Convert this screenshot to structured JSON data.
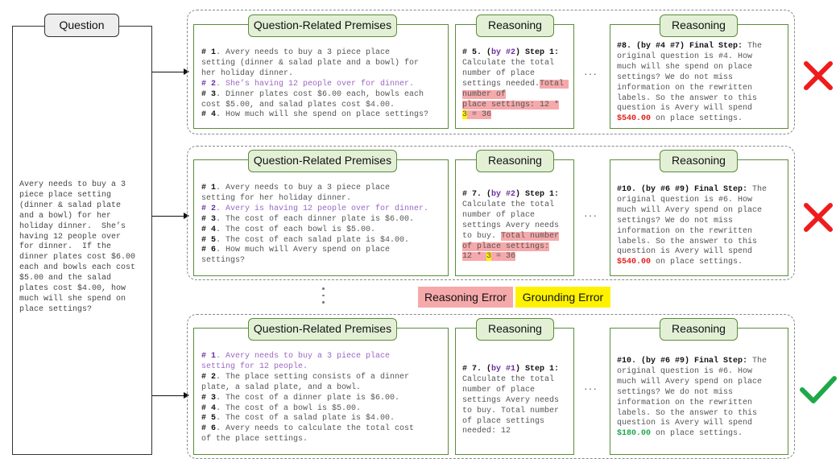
{
  "question": {
    "label": "Question",
    "text": "Avery needs to buy a 3\npiece place setting\n(dinner & salad plate\nand a bowl) for her\nholiday dinner.  She’s\nhaving 12 people over\nfor dinner.  If the\ndinner plates cost $6.00\neach and bowls each cost\n$5.00 and the salad\nplates cost $4.00, how\nmuch will she spend on\nplace settings?"
  },
  "legend": {
    "reasoning_error": "Reasoning Error",
    "grounding_error": "Grounding Error",
    "reasoning_error_color": "#f6a9ab",
    "grounding_error_color": "#fff200"
  },
  "ellipsis": "···",
  "rows": [
    {
      "premises_title": "Question-Related Premises",
      "premises": [
        {
          "num": "# 1",
          "text": ". Avery needs to buy a 3 piece place\nsetting (dinner & salad plate and a bowl) for\nher holiday dinner.",
          "highlight": false
        },
        {
          "num": "# 2",
          "text": ". She’s having 12 people over for dinner.",
          "highlight": true
        },
        {
          "num": "# 3",
          "text": ". Dinner plates cost $6.00 each, bowls each\ncost $5.00, and salad plates cost $4.00.",
          "highlight": false
        },
        {
          "num": "# 4",
          "text": ". How much will she spend on place settings?",
          "highlight": false
        }
      ],
      "step_title": "Reasoning",
      "step": {
        "head_a": "# 5. (",
        "by": "by #2",
        "head_b": ") Step 1:",
        "text": "Calculate the total\nnumber of place\nsettings needed.",
        "error_pre": "Total number of\nplace settings: 12 *\n",
        "error_ground": "3",
        "error_post": " = 36"
      },
      "final_title": "Reasoning",
      "final": {
        "head": "#8. (by #4 #7) Final Step:",
        "text": " The\noriginal question is #4. How\nmuch will she spend on place\nsettings? We do not miss\ninformation on the rewritten\nlabels. So the answer to this\nquestion is Avery will spend\n",
        "amount": "$540.00",
        "tail": " on place settings."
      },
      "verdict": "wrong"
    },
    {
      "premises_title": "Question-Related Premises",
      "premises": [
        {
          "num": "# 1",
          "text": ". Avery needs to buy a 3 piece place\nsetting for her holiday dinner.",
          "highlight": false
        },
        {
          "num": "# 2",
          "text": ". Avery is having 12 people over for dinner.",
          "highlight": true
        },
        {
          "num": "# 3",
          "text": ". The cost of each dinner plate is $6.00.",
          "highlight": false
        },
        {
          "num": "# 4",
          "text": ". The cost of each bowl is $5.00.",
          "highlight": false
        },
        {
          "num": "# 5",
          "text": ". The cost of each salad plate is $4.00.",
          "highlight": false
        },
        {
          "num": "# 6",
          "text": ". How much will Avery spend on place\nsettings?",
          "highlight": false
        }
      ],
      "step_title": "Reasoning",
      "step": {
        "head_a": "# 7. (",
        "by": "by #2",
        "head_b": ") Step 1:",
        "text": "Calculate the total\nnumber of place\nsettings Avery needs\nto buy. ",
        "error_pre": "Total number\nof place settings:\n12 * ",
        "error_ground": "3",
        "error_post": " = 36"
      },
      "final_title": "Reasoning",
      "final": {
        "head": "#10. (by #6 #9) Final Step:",
        "text": " The\noriginal question is #6. How\nmuch will Avery spend on place\nsettings? We do not miss\ninformation on the rewritten\nlabels. So the answer to this\nquestion is Avery will spend\n",
        "amount": "$540.00",
        "tail": " on place settings."
      },
      "verdict": "wrong"
    },
    {
      "premises_title": "Question-Related Premises",
      "premises": [
        {
          "num": "# 1",
          "text": ". Avery needs to buy a 3 piece place\nsetting for 12 people.",
          "highlight": true
        },
        {
          "num": "# 2",
          "text": ". The place setting consists of a dinner\nplate, a salad plate, and a bowl.",
          "highlight": false
        },
        {
          "num": "# 3",
          "text": ". The cost of a dinner plate is $6.00.",
          "highlight": false
        },
        {
          "num": "# 4",
          "text": ". The cost of a bowl is $5.00.",
          "highlight": false
        },
        {
          "num": "# 5",
          "text": ". The cost of a salad plate is $4.00.",
          "highlight": false
        },
        {
          "num": "# 6",
          "text": ". Avery needs to calculate the total cost\nof the place settings.",
          "highlight": false
        }
      ],
      "step_title": "Reasoning",
      "step": {
        "head_a": "# 7. (",
        "by": "by #1",
        "head_b": ") Step 1:",
        "text": "Calculate the total\nnumber of place\nsettings Avery needs\nto buy. Total number\nof place settings\nneeded: 12",
        "error_pre": "",
        "error_ground": "",
        "error_post": ""
      },
      "final_title": "Reasoning",
      "final": {
        "head": "#10. (by #6 #9) Final Step:",
        "text": " The\noriginal question is #6. How\nmuch will Avery spend on place\nsettings? We do not miss\ninformation on the rewritten\nlabels. So the answer to this\nquestion is Avery will spend\n",
        "amount": "$180.00",
        "tail": " on place settings."
      },
      "verdict": "correct"
    }
  ]
}
